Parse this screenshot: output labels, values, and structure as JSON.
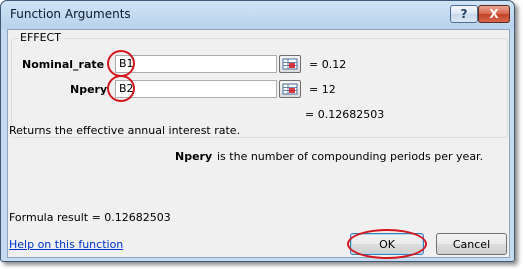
{
  "window": {
    "title": "Function Arguments",
    "help_glyph": "?",
    "close_glyph": "X"
  },
  "group": {
    "label": "EFFECT"
  },
  "arguments": [
    {
      "name": "Nominal_rate",
      "value": "B1",
      "result": "= 0.12"
    },
    {
      "name": "Npery",
      "value": "B2",
      "result": "= 12"
    }
  ],
  "function_result": "= 0.12682503",
  "description": "Returns the effective annual interest rate.",
  "arg_help": {
    "name": "Npery",
    "text": "is the number of compounding periods per year."
  },
  "formula_result": "Formula result =  0.12682503",
  "help_link": "Help on this function",
  "buttons": {
    "ok": "OK",
    "cancel": "Cancel"
  },
  "colors": {
    "annotation": "#d4161d",
    "link": "#0033cc"
  }
}
